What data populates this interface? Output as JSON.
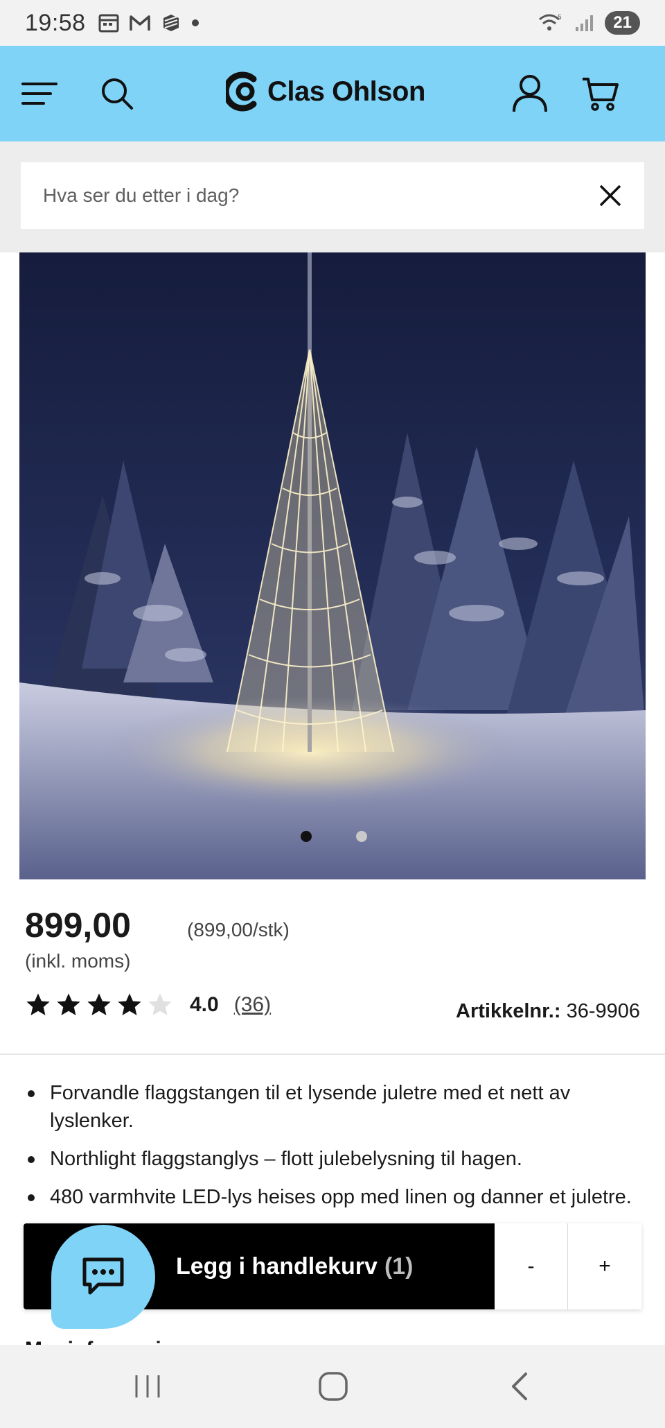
{
  "status_bar": {
    "time": "19:58",
    "battery": "21",
    "icons": [
      "calendar-icon",
      "gmail-icon",
      "app-icon",
      "dot-icon",
      "wifi-icon",
      "signal-icon"
    ]
  },
  "header": {
    "brand": "Clas Ohlson",
    "menu_icon": "hamburger-icon",
    "search_icon": "search-icon",
    "account_icon": "user-icon",
    "cart_icon": "cart-icon"
  },
  "search": {
    "placeholder": "Hva ser du etter i dag?",
    "clear_icon": "close-icon"
  },
  "gallery": {
    "active_index": 0,
    "total": 2
  },
  "product": {
    "price": "899,00",
    "unit_price": "(899,00/stk)",
    "vat_note": "(inkl. moms)",
    "rating_value": "4.0",
    "rating_count": "(36)",
    "rating_stars": 4,
    "article_label": "Artikkelnr.:",
    "article_number": "36-9906",
    "bullets": [
      "Forvandle flaggstangen til et lysende juletre med et nett av lyslenker.",
      "Northlight flaggstanglys – flott julebelysning til hagen.",
      "480 varmhvite LED-lys heises opp med linen og danner et juletre."
    ]
  },
  "cart_bar": {
    "add_label": "Legg i handlekurv",
    "count": "(1)",
    "minus": "-",
    "plus": "+"
  },
  "chat": {
    "icon": "chat-icon"
  },
  "peek_heading": "Mer informasjon",
  "nav": {
    "recent": "recent-apps-icon",
    "home": "home-icon",
    "back": "back-icon"
  },
  "colors": {
    "header_bg": "#7fd3f7",
    "search_bg": "#ededed",
    "cart_bg": "#000000"
  }
}
